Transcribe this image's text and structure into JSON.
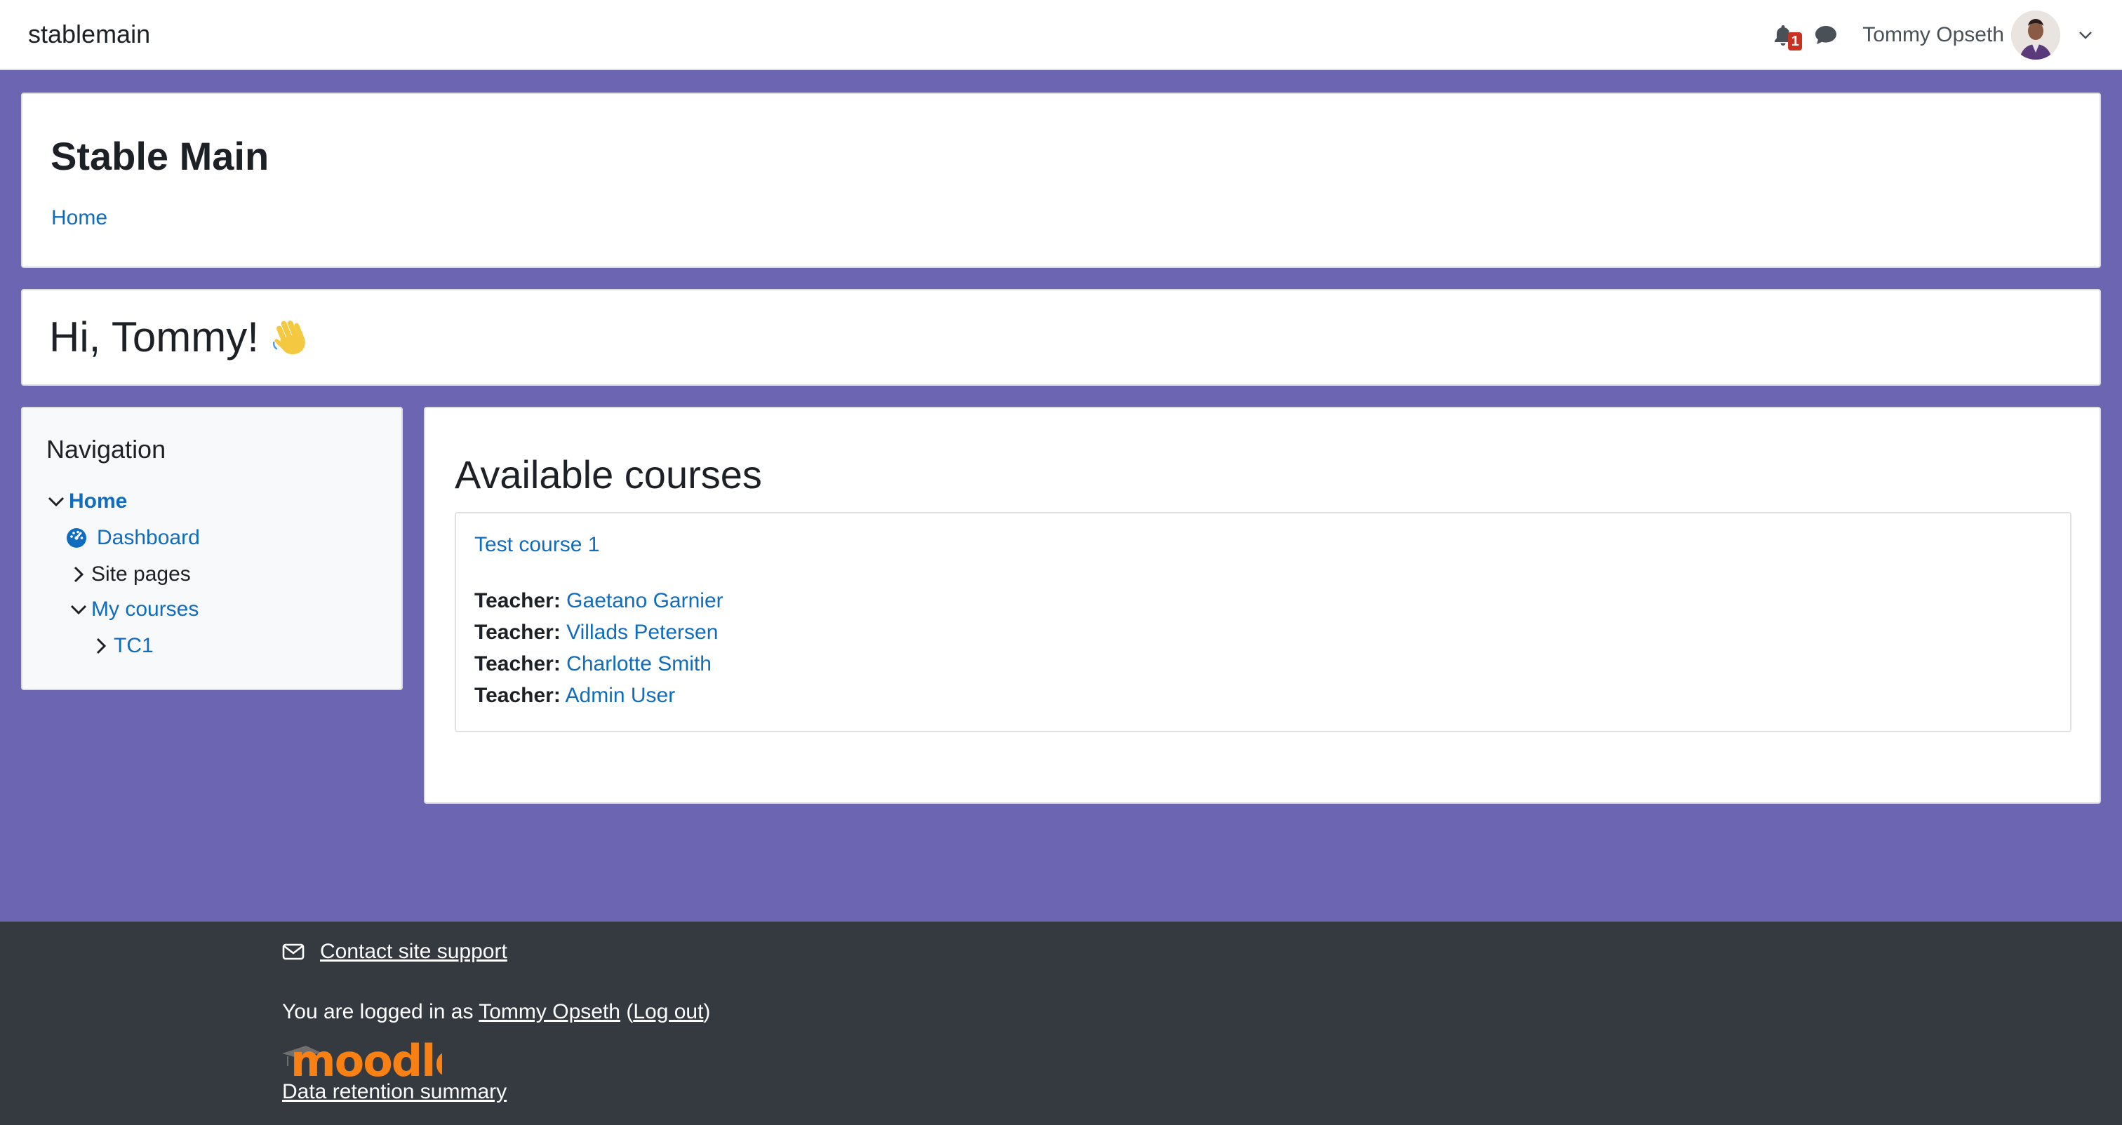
{
  "navbar": {
    "brand": "stablemain",
    "notification_count": "1",
    "user_name": "Tommy Opseth",
    "icons": [
      "bell-icon",
      "chat-icon",
      "chevron-down-icon"
    ]
  },
  "header": {
    "site_title": "Stable Main",
    "breadcrumb_home": "Home"
  },
  "greeting": {
    "text": "Hi, Tommy!"
  },
  "navigation": {
    "title": "Navigation",
    "home": "Home",
    "dashboard": "Dashboard",
    "site_pages": "Site pages",
    "my_courses": "My courses",
    "tc1": "TC1"
  },
  "courses": {
    "title": "Available courses",
    "items": [
      {
        "name": "Test course 1",
        "teachers": [
          {
            "label": "Teacher:",
            "name": "Gaetano Garnier"
          },
          {
            "label": "Teacher:",
            "name": "Villads Petersen"
          },
          {
            "label": "Teacher:",
            "name": "Charlotte Smith"
          },
          {
            "label": "Teacher:",
            "name": "Admin User"
          }
        ]
      }
    ]
  },
  "footer": {
    "contact_support": "Contact site support",
    "logged_in_prefix": "You are logged in as",
    "logged_in_user": "Tommy Opseth",
    "open_paren": "(",
    "logout": "Log out",
    "close_paren": ")",
    "logo_text": "moodle",
    "data_retention": "Data retention summary"
  },
  "colors": {
    "page_background": "#6c66b2",
    "link": "#0f6cbf",
    "footer_background": "#343a40",
    "badge": "#ca3120",
    "moodle_orange": "#f98012"
  }
}
